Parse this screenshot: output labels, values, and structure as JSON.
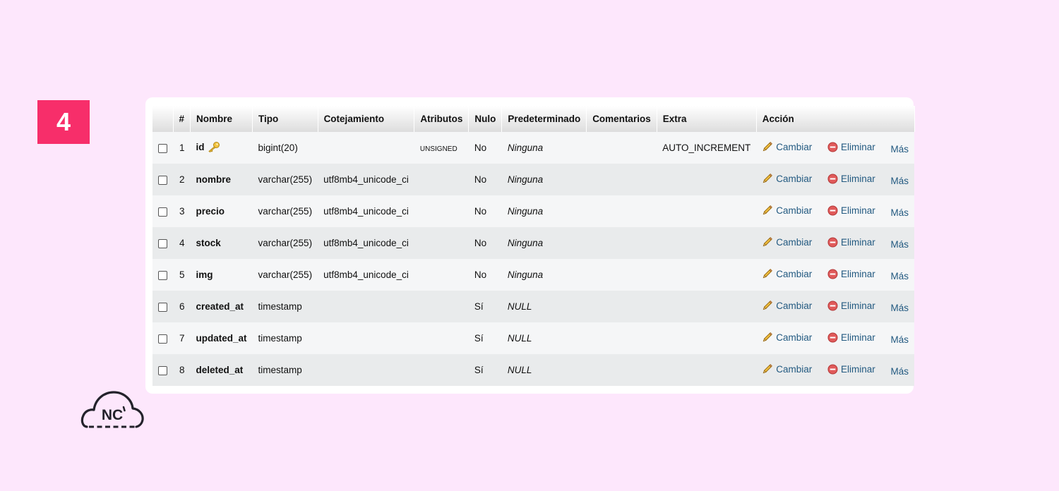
{
  "step": {
    "number": "4"
  },
  "table": {
    "headers": [
      "",
      "#",
      "Nombre",
      "Tipo",
      "Cotejamiento",
      "Atributos",
      "Nulo",
      "Predeterminado",
      "Comentarios",
      "Extra",
      "Acción"
    ],
    "actions": {
      "change": "Cambiar",
      "drop": "Eliminar",
      "more": "Más"
    },
    "rows": [
      {
        "num": "1",
        "name": "id",
        "type": "bigint(20)",
        "collation": "",
        "attributes": "UNSIGNED",
        "null": "No",
        "default": "Ninguna",
        "comments": "",
        "extra": "AUTO_INCREMENT",
        "primary_key": true
      },
      {
        "num": "2",
        "name": "nombre",
        "type": "varchar(255)",
        "collation": "utf8mb4_unicode_ci",
        "attributes": "",
        "null": "No",
        "default": "Ninguna",
        "comments": "",
        "extra": ""
      },
      {
        "num": "3",
        "name": "precio",
        "type": "varchar(255)",
        "collation": "utf8mb4_unicode_ci",
        "attributes": "",
        "null": "No",
        "default": "Ninguna",
        "comments": "",
        "extra": ""
      },
      {
        "num": "4",
        "name": "stock",
        "type": "varchar(255)",
        "collation": "utf8mb4_unicode_ci",
        "attributes": "",
        "null": "No",
        "default": "Ninguna",
        "comments": "",
        "extra": ""
      },
      {
        "num": "5",
        "name": "img",
        "type": "varchar(255)",
        "collation": "utf8mb4_unicode_ci",
        "attributes": "",
        "null": "No",
        "default": "Ninguna",
        "comments": "",
        "extra": ""
      },
      {
        "num": "6",
        "name": "created_at",
        "type": "timestamp",
        "collation": "",
        "attributes": "",
        "null": "Sí",
        "default": "NULL",
        "comments": "",
        "extra": ""
      },
      {
        "num": "7",
        "name": "updated_at",
        "type": "timestamp",
        "collation": "",
        "attributes": "",
        "null": "Sí",
        "default": "NULL",
        "comments": "",
        "extra": ""
      },
      {
        "num": "8",
        "name": "deleted_at",
        "type": "timestamp",
        "collation": "",
        "attributes": "",
        "null": "Sí",
        "default": "NULL",
        "comments": "",
        "extra": ""
      }
    ]
  },
  "logo": {
    "text": "NC"
  },
  "icons": {
    "key": "key-icon",
    "edit": "pencil-icon",
    "drop": "delete-circle-icon",
    "logo": "cloud-icon"
  },
  "colors": {
    "background": "#fde7fc",
    "badge": "#f72e6a",
    "link": "#235a81"
  }
}
